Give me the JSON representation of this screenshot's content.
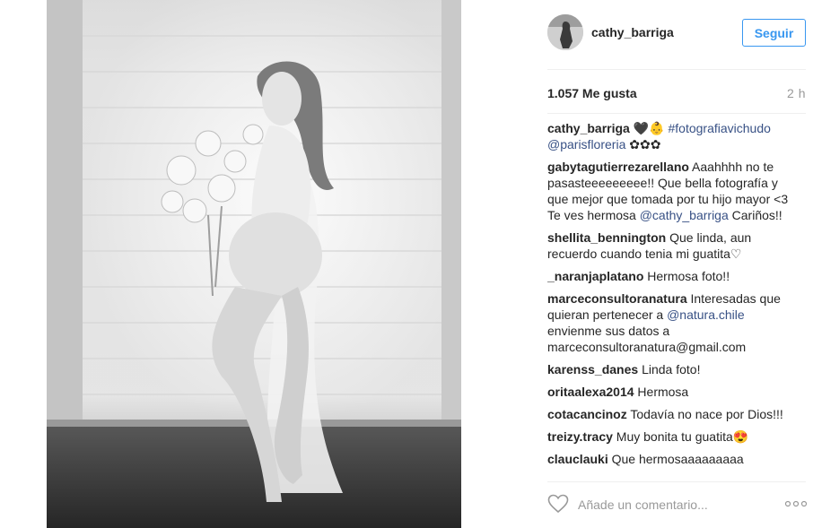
{
  "post": {
    "author": "cathy_barriga",
    "follow_label": "Seguir",
    "likes": "1.057 Me gusta",
    "time": "2 h"
  },
  "caption": {
    "user": "cathy_barriga",
    "emojis": "🖤👶",
    "hashtag": "#fotografiavichudo",
    "mention": "@parisfloreria",
    "flowers": "✿✿✿"
  },
  "comments": [
    {
      "user": "gabytagutierrezarellano",
      "text_before": " Aaahhhh no te pasasteeeeeeeee!! Que bella fotografía y que mejor que tomada por tu hijo mayor <3 Te ves hermosa ",
      "mention": "@cathy_barriga",
      "text_after": " Cariños!!"
    },
    {
      "user": "shellita_bennington",
      "text_before": " Que linda, aun recuerdo cuando tenia mi guatita♡",
      "mention": "",
      "text_after": ""
    },
    {
      "user": "_naranjaplatano",
      "text_before": " Hermosa foto!!",
      "mention": "",
      "text_after": ""
    },
    {
      "user": "marceconsultoranatura",
      "text_before": " Interesadas que quieran pertenecer a ",
      "mention": "@natura.chile",
      "text_after": " envienme sus datos a marceconsultoranatura@gmail.com"
    },
    {
      "user": "karenss_danes",
      "text_before": " Linda foto!",
      "mention": "",
      "text_after": ""
    },
    {
      "user": "oritaalexa2014",
      "text_before": " Hermosa",
      "mention": "",
      "text_after": ""
    },
    {
      "user": "cotacancinoz",
      "text_before": " Todavía no nace por Dios!!!",
      "mention": "",
      "text_after": ""
    },
    {
      "user": "treizy.tracy",
      "text_before": " Muy bonita tu guatita😍",
      "mention": "",
      "text_after": ""
    },
    {
      "user": "clauclauki",
      "text_before": " Que hermosaaaaaaaaa",
      "mention": "",
      "text_after": ""
    }
  ],
  "comment_bar": {
    "placeholder": "Añade un comentario...",
    "like_icon": "heart-outline-icon",
    "more_icon": "more-options-icon"
  },
  "colors": {
    "accent": "#3897f0",
    "link": "#385185",
    "muted": "#999999"
  }
}
